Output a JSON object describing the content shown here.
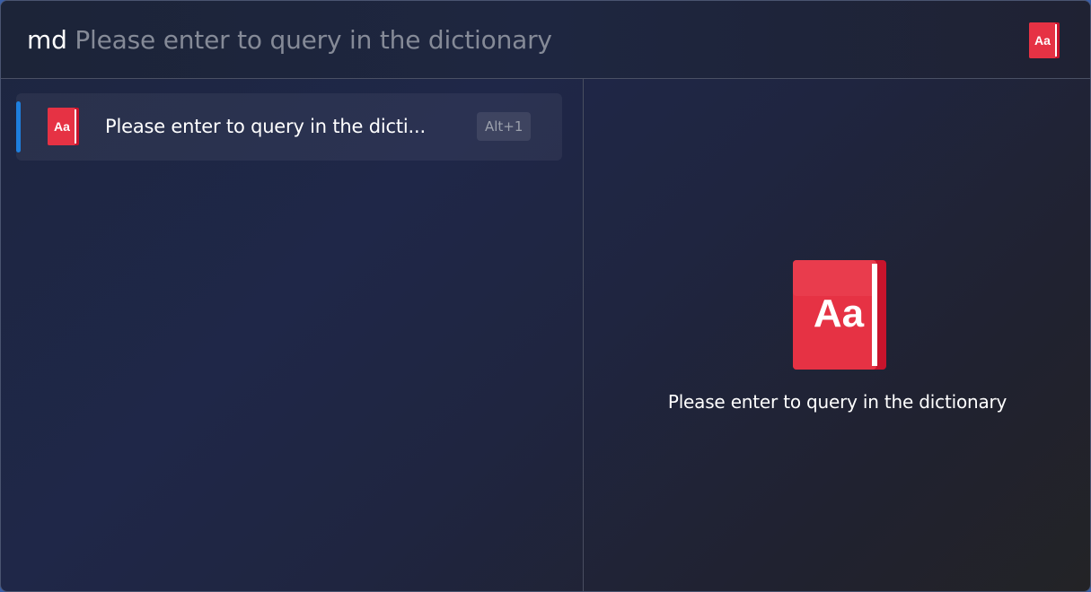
{
  "query": {
    "typed": "md",
    "placeholder_hint": "Please enter to query in the dictionary"
  },
  "plugin_icon": {
    "name": "dictionary-book-icon",
    "label": "Aa",
    "color": "#e63244",
    "spine_color": "#ffffff"
  },
  "results": [
    {
      "title": "Please enter to query in the dicti...",
      "hotkey": "Alt+1",
      "selected": true,
      "accent_color": "#1e7fde"
    }
  ],
  "preview": {
    "text": "Please enter to query in the dictionary"
  }
}
